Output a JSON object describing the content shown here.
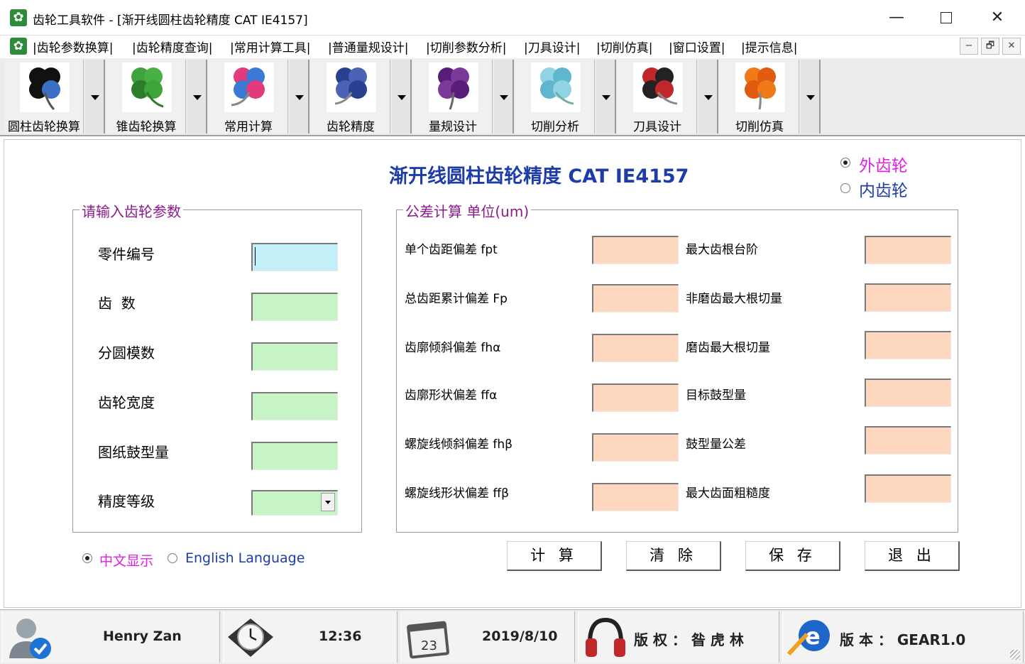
{
  "window": {
    "title": "齿轮工具软件 - [渐开线圆柱齿轮精度 CAT IE4157]",
    "icon": "gear-app-icon",
    "controls": {
      "minimize": "—",
      "close": "✕"
    }
  },
  "menu": {
    "items": [
      "|齿轮参数换算|",
      "|齿轮精度查询|",
      "|常用计算工具|",
      "|普通量规设计|",
      "|切削参数分析|",
      "|刀具设计|",
      "|切削仿真|",
      "|窗口设置|",
      "|提示信息|"
    ],
    "mdi": {
      "minimize": "−",
      "restore": "🗗",
      "close": "✕"
    }
  },
  "toolbar": {
    "buttons": [
      {
        "label": "圆柱齿轮换算",
        "icon": "clover-black-blue-icon",
        "colors": [
          "#111111",
          "#3a6fc4"
        ]
      },
      {
        "label": "锥齿轮换算",
        "icon": "clover-green-icon",
        "colors": [
          "#3fa33b",
          "#2b7d2a"
        ]
      },
      {
        "label": "常用计算",
        "icon": "clover-multicolor-icon",
        "colors": [
          "#e23a7a",
          "#3a7ad6"
        ]
      },
      {
        "label": "齿轮精度",
        "icon": "clover-darkblue-icon",
        "colors": [
          "#2a3f8f",
          "#4a63b6"
        ]
      },
      {
        "label": "量规设计",
        "icon": "clover-purple-icon",
        "colors": [
          "#5b1d7a",
          "#7b3a9a"
        ]
      },
      {
        "label": "切削分析",
        "icon": "clover-lightblue-icon",
        "colors": [
          "#8fd3e4",
          "#5fb6cf"
        ]
      },
      {
        "label": "刀具设计",
        "icon": "clover-red-black-icon",
        "colors": [
          "#c1262b",
          "#222222"
        ]
      },
      {
        "label": "切削仿真",
        "icon": "clover-orange-icon",
        "colors": [
          "#f07a1a",
          "#e05a10"
        ]
      }
    ]
  },
  "page": {
    "title": "渐开线圆柱齿轮精度 CAT IE4157",
    "gear_type": {
      "options": [
        "外齿轮",
        "内齿轮"
      ],
      "selected": "外齿轮"
    }
  },
  "input_group": {
    "title": "请输入齿轮参数",
    "fields": [
      {
        "label": "零件编号",
        "value": ""
      },
      {
        "label": "齿  数",
        "value": ""
      },
      {
        "label": "分圆模数",
        "value": ""
      },
      {
        "label": "齿轮宽度",
        "value": ""
      },
      {
        "label": "图纸鼓型量",
        "value": ""
      },
      {
        "label": "精度等级",
        "value": ""
      }
    ]
  },
  "tolerance_group": {
    "title": "公差计算 单位(um)",
    "left": [
      {
        "label": "单个齿距偏差 fpt",
        "value": ""
      },
      {
        "label": "总齿距累计偏差 Fp",
        "value": ""
      },
      {
        "label": "齿廓倾斜偏差 fhα",
        "value": ""
      },
      {
        "label": "齿廓形状偏差 ffα",
        "value": ""
      },
      {
        "label": "螺旋线倾斜偏差 fhβ",
        "value": ""
      },
      {
        "label": "螺旋线形状偏差 ffβ",
        "value": ""
      }
    ],
    "right": [
      {
        "label": "最大齿根台阶",
        "value": ""
      },
      {
        "label": "非磨齿最大根切量",
        "value": ""
      },
      {
        "label": "磨齿最大根切量",
        "value": ""
      },
      {
        "label": "目标鼓型量",
        "value": ""
      },
      {
        "label": "鼓型量公差",
        "value": ""
      },
      {
        "label": "最大齿面粗糙度",
        "value": ""
      }
    ]
  },
  "language": {
    "options": [
      "中文显示",
      "English Language"
    ],
    "selected": "中文显示"
  },
  "actions": {
    "calculate": "计 算",
    "clear": "清 除",
    "save": "保 存",
    "exit": "退 出"
  },
  "status": {
    "user": "Henry Zan",
    "time": "12:36",
    "date": "2019/8/10",
    "calendar_day": "23",
    "copyright": "版 权 ： 昝 虎 林",
    "version": "版 本 ： GEAR1.0"
  },
  "colors": {
    "title_text": "#1e3ca8",
    "group_title": "#8b1a8b",
    "selected_option": "#e020e0",
    "unselected_option": "#1e3ca8",
    "input_green": "#c6f4c6",
    "input_cyan": "#c3f0f8",
    "result_peach": "#fdd8bf"
  }
}
